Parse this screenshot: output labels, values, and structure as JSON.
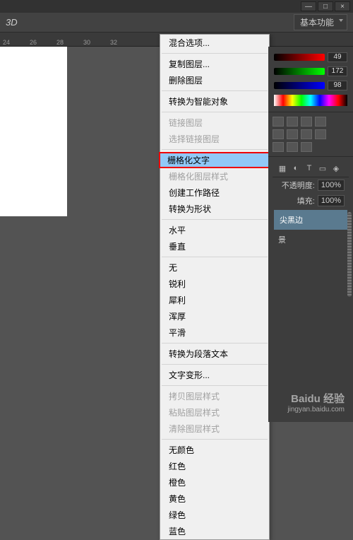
{
  "titlebar": {
    "minimize": "—",
    "maximize": "□",
    "close": "×"
  },
  "toolbar": {
    "tab_3d": "3D",
    "workspace": "基本功能"
  },
  "ruler": {
    "marks": [
      "24",
      "26",
      "28",
      "30",
      "32"
    ]
  },
  "menu": {
    "blend_options": "混合选项...",
    "copy_layer": "复制图层...",
    "delete_layer": "删除图层",
    "convert_smart": "转换为智能对象",
    "link_layers": "链接图层",
    "select_linked": "选择链接图层",
    "rasterize_text": "栅格化文字",
    "rasterize_style": "栅格化图层样式",
    "create_workpath": "创建工作路径",
    "convert_shape": "转换为形状",
    "horizontal": "水平",
    "vertical": "垂直",
    "none": "无",
    "sharp": "锐利",
    "crisp": "犀利",
    "strong": "浑厚",
    "smooth": "平滑",
    "convert_paragraph": "转换为段落文本",
    "warp_text": "文字变形...",
    "copy_style": "拷贝图层样式",
    "paste_style": "粘贴图层样式",
    "clear_style": "清除图层样式",
    "no_color": "无颜色",
    "red": "红色",
    "orange": "橙色",
    "yellow": "黄色",
    "green": "绿色",
    "blue": "蓝色"
  },
  "color": {
    "r": "49",
    "g": "172",
    "b": "98"
  },
  "layers": {
    "opacity_label": "不透明度:",
    "opacity_val": "100%",
    "fill_label": "填充:",
    "fill_val": "100%",
    "layer_black_edge": "尖黑边",
    "layer_effects": "景"
  },
  "watermark": {
    "brand": "Baidu 经验",
    "url": "jingyan.baidu.com"
  }
}
